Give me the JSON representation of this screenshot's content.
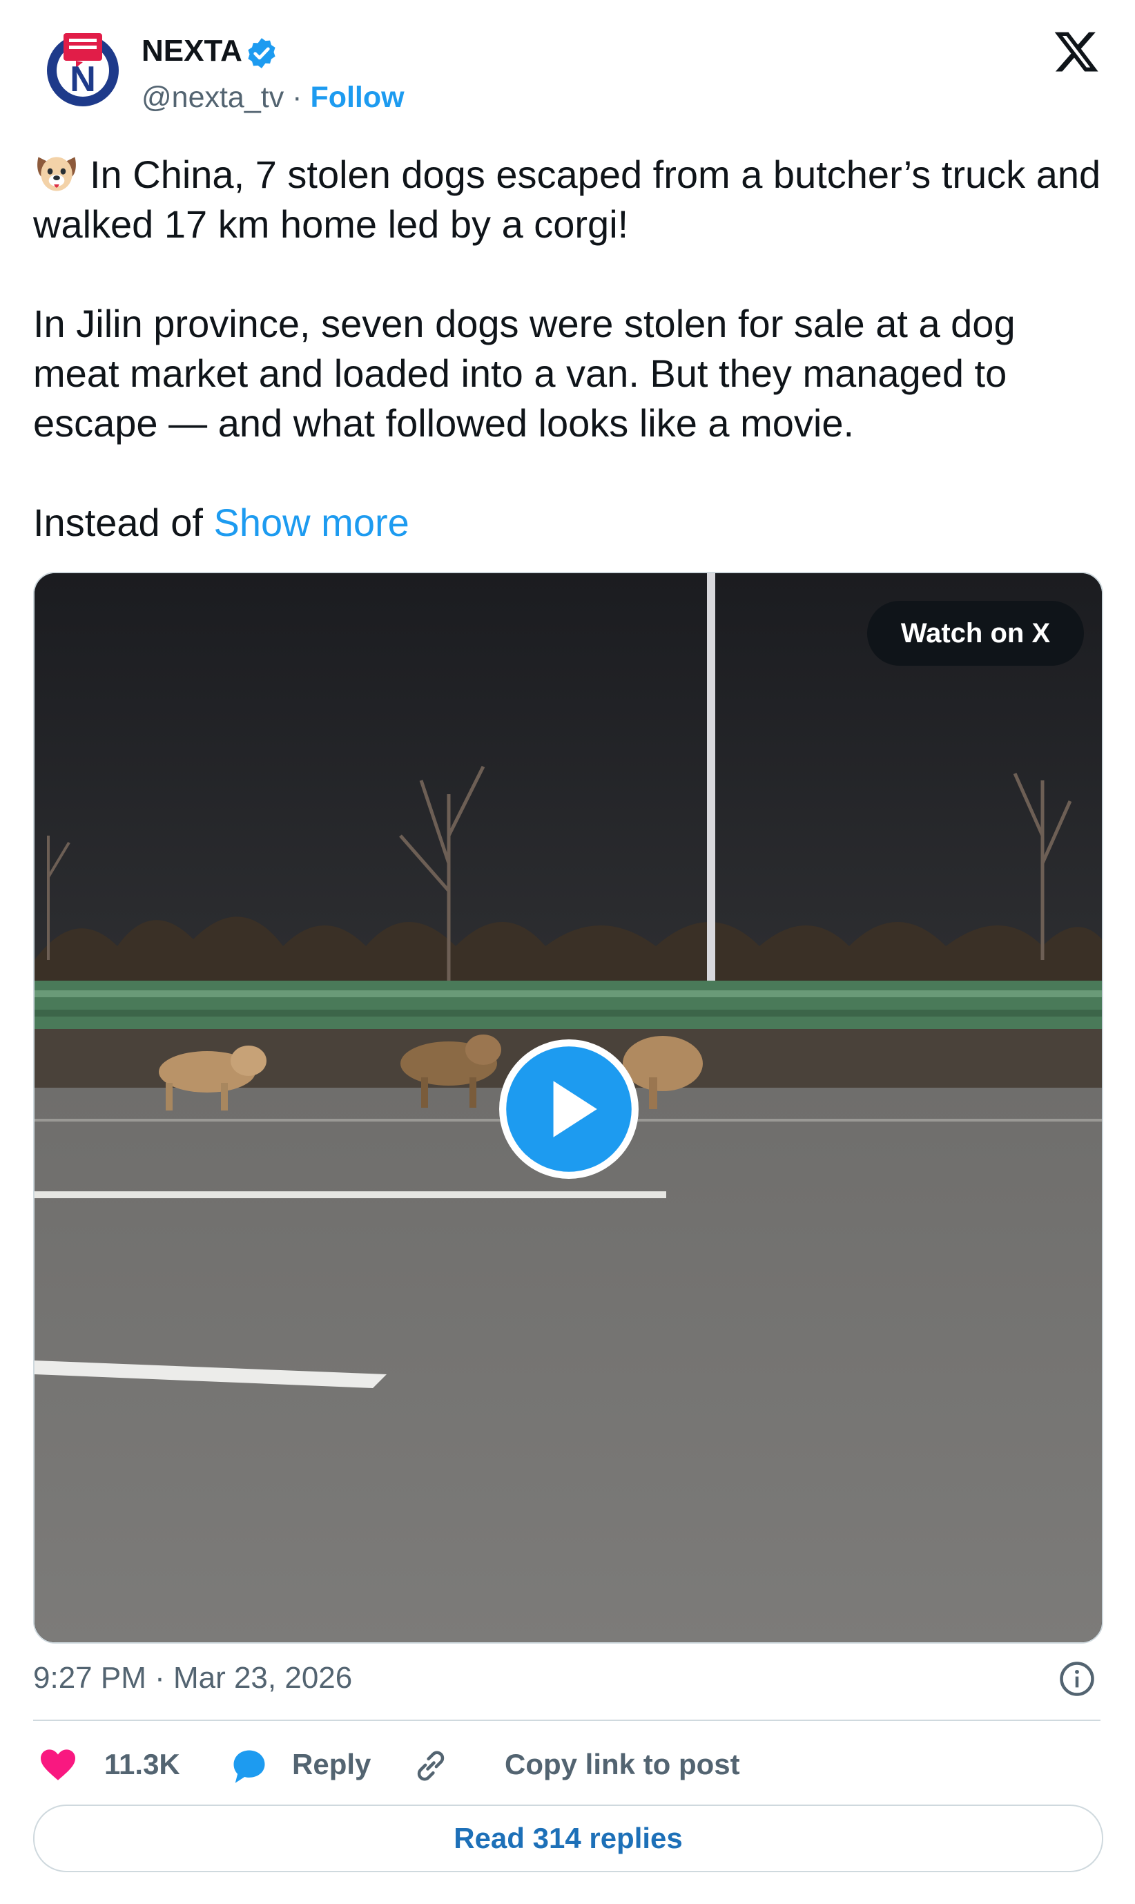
{
  "author": {
    "name": "NEXTA",
    "handle": "@nexta_tv",
    "separator": "·",
    "follow_label": "Follow",
    "avatar_icon": "nexta-logo-icon",
    "verified_icon": "verified-badge-icon"
  },
  "platform_icon": "x-logo-icon",
  "tweet": {
    "emoji_icon": "dog-face-icon",
    "line1": "In China, 7 stolen dogs escaped from a butcher’s truck and walked 17 km home led by a corgi!",
    "line2": "In Jilin province, seven dogs were stolen for sale at a dog meat market and loaded into a van. But they managed to escape — and what followed looks like a movie.",
    "line3": "Instead of",
    "show_more": "Show more"
  },
  "media": {
    "watch_label": "Watch on X",
    "play_icon": "play-icon"
  },
  "timestamp": "9:27 PM · Mar 23, 2026",
  "info_icon": "info-icon",
  "actions": {
    "like_count": "11.3K",
    "reply_label": "Reply",
    "copy_label": "Copy link to post"
  },
  "read_replies_label": "Read 314 replies",
  "colors": {
    "accent": "#1d9bf0",
    "like": "#f91880",
    "text": "#0f1419",
    "muted": "#536471",
    "border": "#cfd9de"
  }
}
